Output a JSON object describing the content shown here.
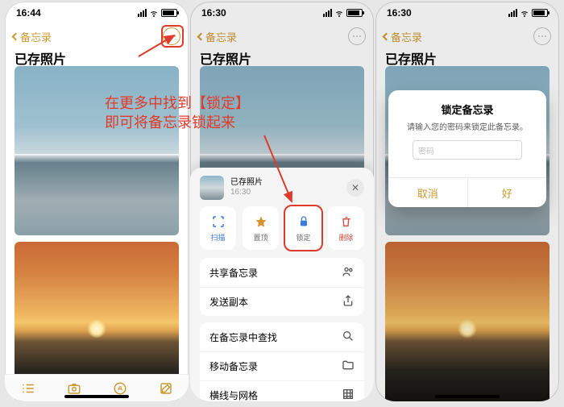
{
  "status": {
    "t1": "16:44",
    "t2": "16:30",
    "t3": "16:30"
  },
  "nav": {
    "back": "备忘录"
  },
  "title": "已存照片",
  "annotation": {
    "line1": "在更多中找到【锁定】",
    "line2": "即可将备忘录锁起来"
  },
  "sheet": {
    "preview_title": "已存照片",
    "preview_time": "16:30",
    "actions": {
      "scan": "扫描",
      "pin": "置顶",
      "lock": "锁定",
      "delete": "删除"
    },
    "menu1": {
      "share": "共享备忘录",
      "send_copy": "发送副本"
    },
    "menu2": {
      "find": "在备忘录中查找",
      "move": "移动备忘录",
      "lines": "横线与网格"
    }
  },
  "alert": {
    "title": "锁定备忘录",
    "message": "请输入您的密码来锁定此备忘录。",
    "placeholder": "密码",
    "cancel": "取消",
    "ok": "好"
  }
}
